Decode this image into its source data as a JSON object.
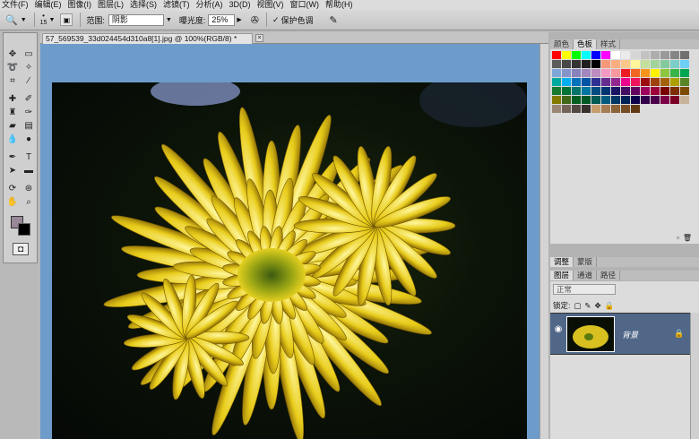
{
  "menu": [
    "文件(F)",
    "编辑(E)",
    "图像(I)",
    "图层(L)",
    "选择(S)",
    "滤镜(T)",
    "分析(A)",
    "3D(D)",
    "视图(V)",
    "窗口(W)",
    "帮助(H)"
  ],
  "options": {
    "brush_size": "15",
    "range_label": "范围:",
    "range_value": "阴影",
    "exposure_label": "曝光度:",
    "exposure_value": "25%",
    "protect_label": "保护色调"
  },
  "document": {
    "tab_title": "57_569539_33d024454d310a8[1].jpg @ 100%(RGB/8) *",
    "close_glyph": "×"
  },
  "panels": {
    "top_tabs": [
      "颜色",
      "色板",
      "样式"
    ],
    "top_active": "色板",
    "mid_tabs": [
      "调整",
      "蒙版"
    ],
    "layer_tabs": [
      "图层",
      "通道",
      "路径"
    ],
    "layer_active": "图层",
    "blend_mode": "正常",
    "lock_label": "锁定:",
    "layer_name": "背景"
  },
  "swatches": [
    "#ff0000",
    "#ffff00",
    "#00ff00",
    "#00ffff",
    "#0000ff",
    "#ff00ff",
    "#ffffff",
    "#ebebeb",
    "#d6d6d6",
    "#c2c2c2",
    "#adadad",
    "#999999",
    "#858585",
    "#707070",
    "#5c5c5c",
    "#474747",
    "#333333",
    "#1f1f1f",
    "#000000",
    "#f7977a",
    "#f9ad81",
    "#fdc68a",
    "#fff79a",
    "#c4df9b",
    "#a2d39c",
    "#82ca9d",
    "#7bcdc8",
    "#6ecff6",
    "#7ea7d8",
    "#8493ca",
    "#8882be",
    "#a187be",
    "#bc8dbf",
    "#f49ac2",
    "#f6989d",
    "#ed1c24",
    "#f26522",
    "#f7941d",
    "#fff200",
    "#8dc73f",
    "#39b54a",
    "#00a651",
    "#00a99d",
    "#00aeef",
    "#0072bc",
    "#0054a6",
    "#2e3192",
    "#662d91",
    "#92278f",
    "#ec008c",
    "#ed145b",
    "#9e0b0f",
    "#a0410d",
    "#a36209",
    "#aba000",
    "#598527",
    "#1a7b30",
    "#007236",
    "#00746b",
    "#0076a3",
    "#004b80",
    "#003471",
    "#1b1464",
    "#440e62",
    "#630460",
    "#9e005d",
    "#9e0039",
    "#790000",
    "#7b2e00",
    "#7d4900",
    "#827b00",
    "#406618",
    "#005e20",
    "#005826",
    "#005952",
    "#005b7f",
    "#003663",
    "#002157",
    "#0d004c",
    "#32004b",
    "#4b0049",
    "#7b0046",
    "#7a0026",
    "#c7b299",
    "#998675",
    "#736357",
    "#534741",
    "#37302d",
    "#c69c6d",
    "#a67c52",
    "#8c6239",
    "#754c24",
    "#603913"
  ],
  "colors": {
    "doc_bg": "#6d9ccb",
    "layer_selected": "#506788",
    "fg_swatch": "#9a8898",
    "bg_swatch": "#000000"
  }
}
